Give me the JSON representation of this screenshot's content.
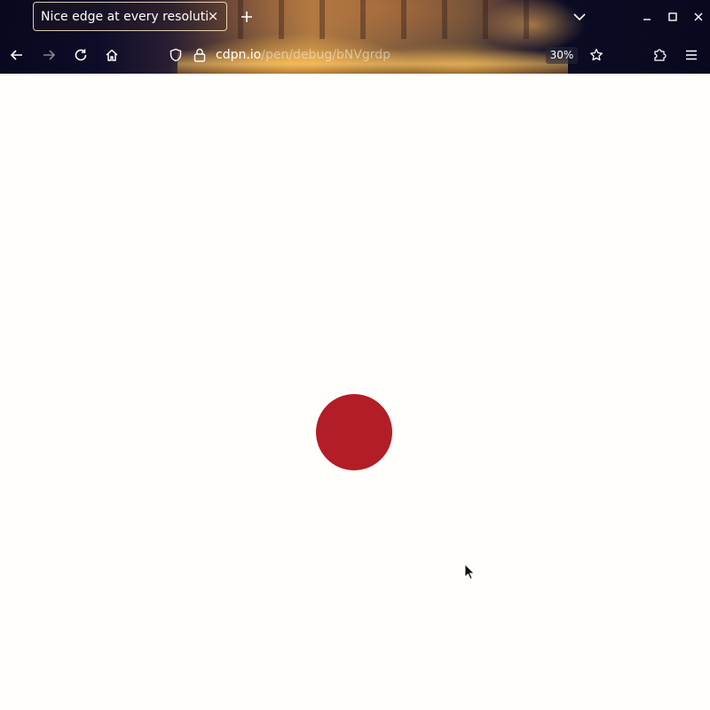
{
  "browser": {
    "tab": {
      "title": "Nice edge at every resolution",
      "close_glyph": "×"
    },
    "new_tab_glyph": "+",
    "url": {
      "host": "cdpn.io",
      "path": "/pen/debug/bNVgrdp"
    },
    "zoom": "30%",
    "icons": {
      "back": "back-arrow-icon",
      "forward": "forward-arrow-icon",
      "reload": "reload-icon",
      "home": "home-icon",
      "shield": "shield-icon",
      "lock": "lock-icon",
      "bookmark": "star-icon",
      "extensions": "puzzle-icon",
      "menu": "hamburger-menu-icon",
      "tab_list": "chevron-down-icon",
      "minimize": "minimize-icon",
      "maximize": "maximize-icon",
      "close_window": "close-icon"
    }
  },
  "page": {
    "circle_color": "#b31d27",
    "background": "#fffefb"
  }
}
